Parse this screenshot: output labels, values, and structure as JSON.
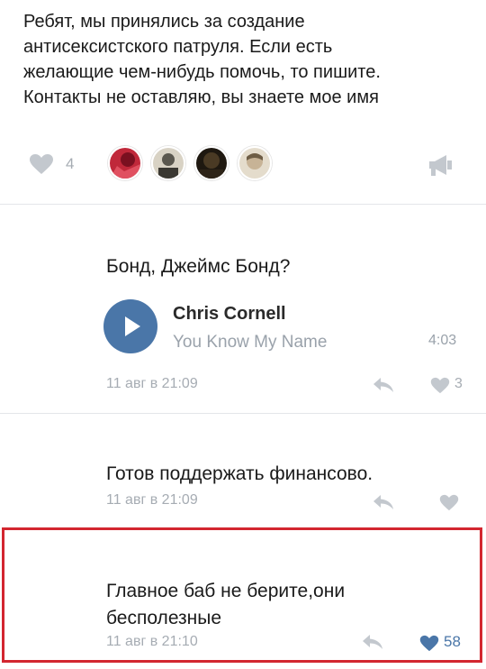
{
  "post": {
    "lines": [
      "Ребят, мы принялись за создание",
      "антисексистского патруля.  Если есть",
      "желающие чем-нибудь помочь, то пишите.",
      "Контакты не оставляю, вы знаете мое имя"
    ],
    "likes": "4",
    "avatars": [
      {
        "name": "avatar-1",
        "colors": [
          "#c0283a",
          "#7a1020"
        ]
      },
      {
        "name": "avatar-2",
        "colors": [
          "#d8d2c4",
          "#5a574e"
        ]
      },
      {
        "name": "avatar-3",
        "colors": [
          "#4a3a24",
          "#1e1810"
        ]
      },
      {
        "name": "avatar-4",
        "colors": [
          "#c7b396",
          "#6e5d45"
        ]
      }
    ]
  },
  "comments": [
    {
      "text": "Бонд, Джеймс Бонд?",
      "audio": {
        "artist": "Chris Cornell",
        "title": "You Know My Name",
        "duration": "4:03"
      },
      "date": "11 авг в 21:09",
      "likes": "3"
    },
    {
      "text": "Готов поддержать финансово.",
      "date": "11 авг в 21:09",
      "likes": ""
    },
    {
      "text_lines": [
        "Главное баб не берите,они",
        "бесполезные"
      ],
      "date": "11 авг в 21:10",
      "likes": "58",
      "liked": true
    }
  ],
  "colors": {
    "accent": "#4a76a8",
    "icon_grey": "#c3c8ce",
    "highlight": "#d32630"
  }
}
